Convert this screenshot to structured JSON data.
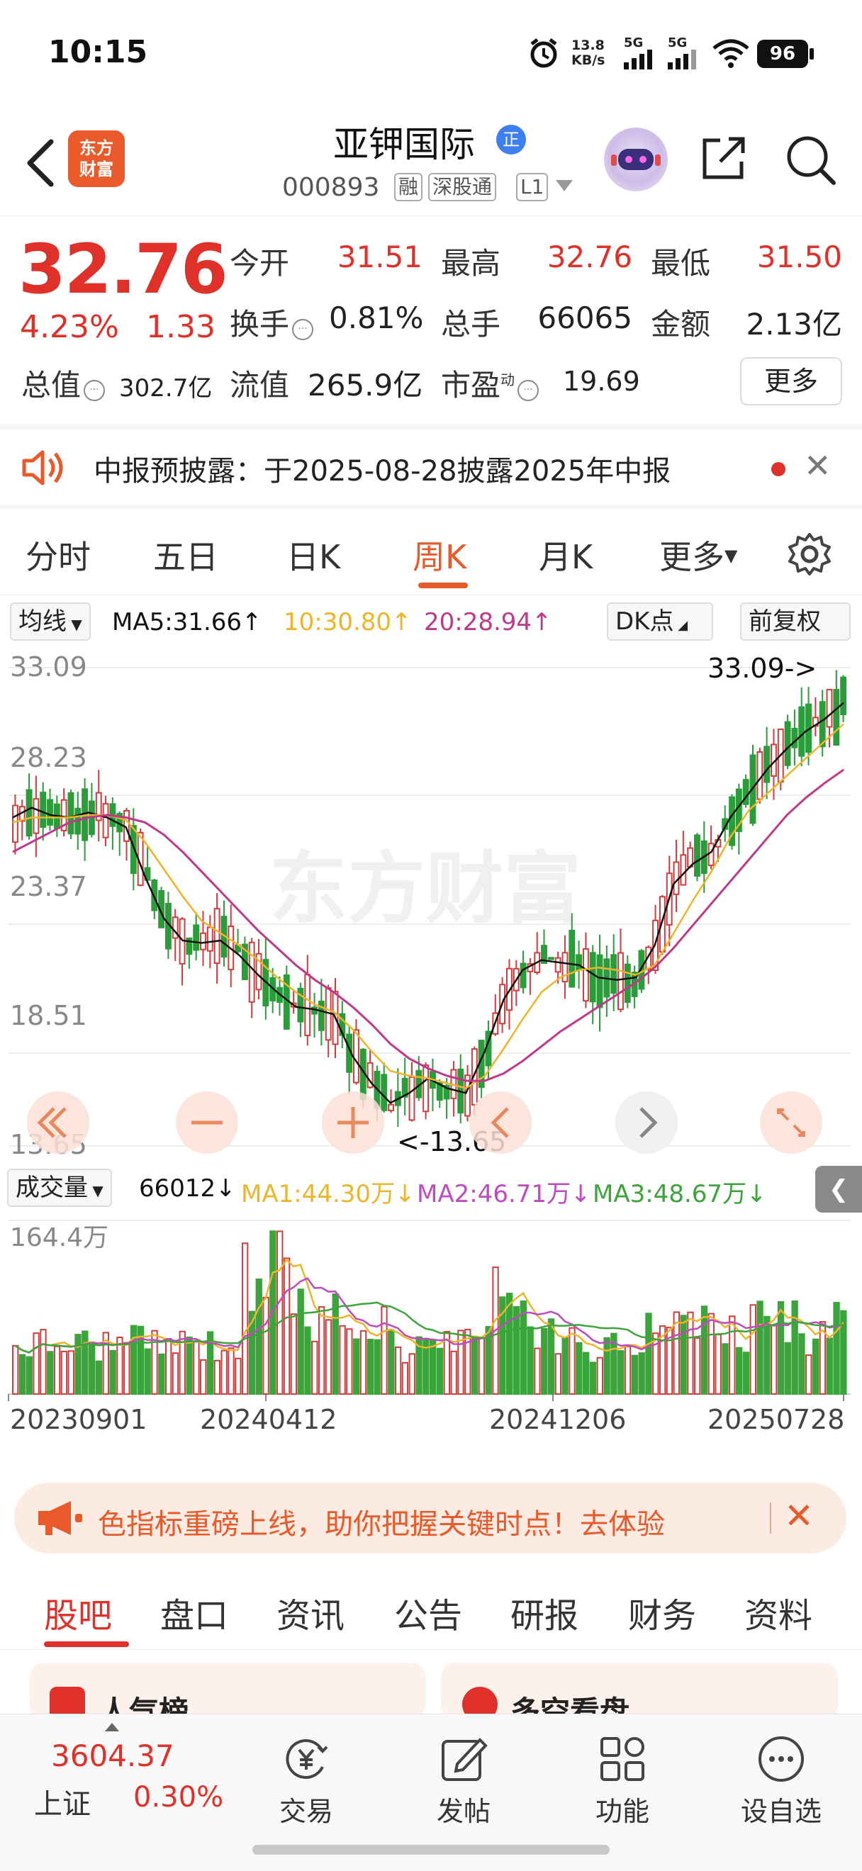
{
  "status_bar": {
    "time": "10:15",
    "net_speed": "13.8\nKB/s",
    "signal1": "5G",
    "signal2": "5G",
    "battery": "96"
  },
  "header": {
    "logo_text": "东方\n财富",
    "stock_name": "亚钾国际",
    "badge": "正",
    "code": "000893",
    "tags": [
      "融",
      "深股通",
      "L1"
    ]
  },
  "quote": {
    "price": "32.76",
    "change_pct": "4.23%",
    "change_amt": "1.33",
    "open_label": "今开",
    "open": "31.51",
    "high_label": "最高",
    "high": "32.76",
    "low_label": "最低",
    "low": "31.50",
    "turnover_label": "换手",
    "turnover": "0.81%",
    "volume_label": "总手",
    "volume": "66065",
    "amount_label": "金额",
    "amount": "2.13亿",
    "total_cap_label": "总值",
    "total_cap": "302.7亿",
    "float_cap_label": "流值",
    "float_cap": "265.9亿",
    "pe_label": "市盈",
    "pe_sup": "动",
    "pe": "19.69",
    "more": "更多"
  },
  "notice": {
    "text": "中报预披露：于2025-08-28披露2025年中报"
  },
  "period_tabs": [
    "分时",
    "五日",
    "日K",
    "周K",
    "月K",
    "更多"
  ],
  "ma_row": {
    "selector": "均线",
    "ma5": "MA5:31.66↑",
    "ma10": "10:30.80↑",
    "ma20": "20:28.94↑",
    "dk": "DK点",
    "adjust": "前复权"
  },
  "chart_data": [
    {
      "type": "candlestick",
      "title": "",
      "y_ticks": [
        "33.09",
        "28.23",
        "23.37",
        "18.51",
        "13.65"
      ],
      "ylim": [
        13.65,
        33.09
      ],
      "max_label": "33.09->",
      "min_label": "<-13.65",
      "watermark": "东方财富",
      "series": [
        {
          "name": "MA5",
          "color": "#111111",
          "values": [
            27.0,
            27.4,
            27.1,
            27.0,
            27.2,
            27.0,
            26.6,
            24.6,
            22.9,
            22.0,
            21.9,
            22.0,
            21.4,
            20.6,
            19.9,
            19.3,
            19.2,
            19.0,
            17.3,
            16.2,
            15.4,
            15.8,
            16.4,
            16.0,
            15.8,
            17.5,
            19.6,
            20.8,
            21.2,
            21.1,
            21.0,
            20.5,
            20.4,
            20.5,
            21.8,
            24.3,
            25.1,
            25.6,
            27.0,
            28.0,
            29.0,
            29.8,
            30.5,
            31.0,
            31.66
          ]
        },
        {
          "name": "MA10",
          "color": "#f0b429",
          "values": [
            26.8,
            27.0,
            27.0,
            27.0,
            27.1,
            27.1,
            26.9,
            26.0,
            24.9,
            23.8,
            22.8,
            22.3,
            21.8,
            21.2,
            20.5,
            19.9,
            19.4,
            19.1,
            18.4,
            17.5,
            16.7,
            16.5,
            16.4,
            16.2,
            16.0,
            16.5,
            17.6,
            18.8,
            19.9,
            20.5,
            20.8,
            20.9,
            20.8,
            20.6,
            21.0,
            22.3,
            23.6,
            24.8,
            26.2,
            27.3,
            28.0,
            28.7,
            29.4,
            30.1,
            30.8
          ]
        },
        {
          "name": "MA20",
          "color": "#c0388a",
          "values": [
            25.6,
            26.0,
            26.4,
            26.8,
            27.0,
            27.1,
            27.0,
            26.8,
            26.3,
            25.6,
            24.8,
            24.0,
            23.2,
            22.4,
            21.7,
            21.0,
            20.4,
            19.9,
            19.3,
            18.6,
            17.8,
            17.2,
            16.8,
            16.5,
            16.3,
            16.3,
            16.6,
            17.1,
            17.7,
            18.3,
            18.8,
            19.3,
            19.8,
            20.3,
            20.9,
            21.7,
            22.6,
            23.5,
            24.4,
            25.3,
            26.2,
            27.1,
            27.8,
            28.4,
            28.94
          ]
        }
      ]
    },
    {
      "type": "bar",
      "title": "",
      "selector": "成交量",
      "current": "66012↓",
      "ma1": "MA1:44.30万↓",
      "ma2": "MA2:46.71万↓",
      "ma3": "MA3:48.67万↓",
      "y_max_label": "164.4万",
      "x_ticks": [
        "20230901",
        "20240412",
        "20241206",
        "20250728"
      ],
      "colors": {
        "up": "#d23c3c",
        "down": "#3ba53b",
        "ma1": "#f0b429",
        "ma2": "#c04ac0",
        "ma3": "#3ba53b"
      }
    }
  ],
  "banner": {
    "text": "色指标重磅上线，助你把握关键时点！去体验"
  },
  "content_tabs": [
    "股吧",
    "盘口",
    "资讯",
    "公告",
    "研报",
    "财务",
    "资料"
  ],
  "cards": [
    "人气榜",
    "多空看盘"
  ],
  "footer": {
    "index_value": "3604.37",
    "index_name": "上证",
    "index_pct": "0.30%",
    "nav": [
      "交易",
      "发帖",
      "功能",
      "设自选"
    ]
  }
}
